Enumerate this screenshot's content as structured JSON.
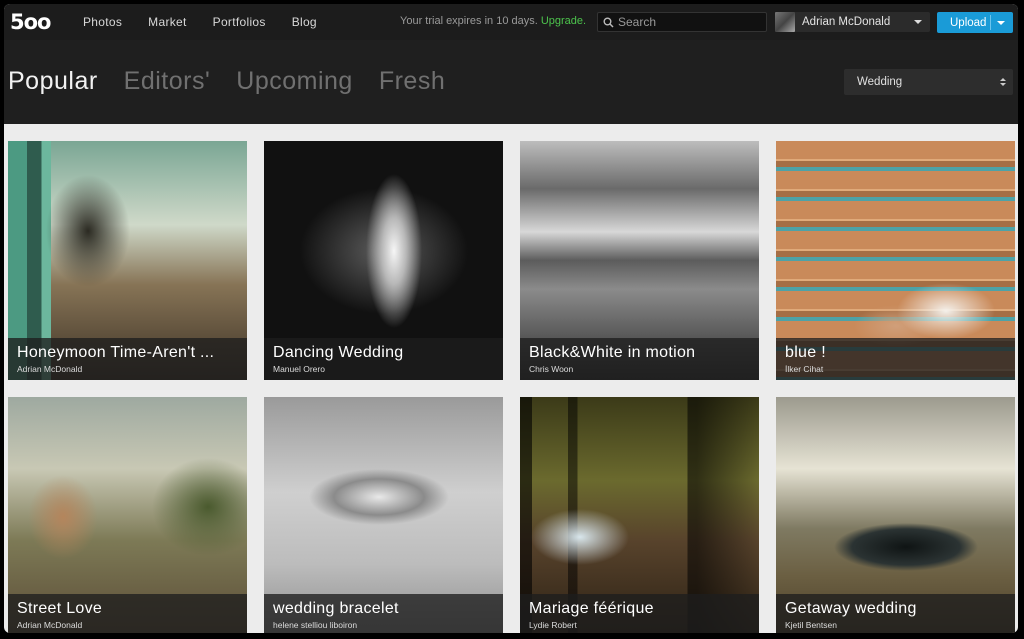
{
  "header": {
    "logo": "5oo",
    "nav": [
      "Photos",
      "Market",
      "Portfolios",
      "Blog"
    ],
    "trial_text": "Your trial expires in 10 days.",
    "trial_link": "Upgrade.",
    "search_placeholder": "Search",
    "user_name": "Adrian McDonald",
    "upload_label": "Upload"
  },
  "subheader": {
    "tabs": [
      {
        "label": "Popular",
        "active": true
      },
      {
        "label": "Editors'",
        "active": false
      },
      {
        "label": "Upcoming",
        "active": false
      },
      {
        "label": "Fresh",
        "active": false
      }
    ],
    "category": "Wedding"
  },
  "photos": [
    {
      "title": "Honeymoon Time-Aren't ...",
      "author": "Adrian McDonald"
    },
    {
      "title": "Dancing Wedding",
      "author": "Manuel Orero"
    },
    {
      "title": "Black&White in motion",
      "author": "Chris Woon"
    },
    {
      "title": "blue !",
      "author": "İlker Cihat"
    },
    {
      "title": "Street Love",
      "author": "Adrian McDonald"
    },
    {
      "title": "wedding bracelet",
      "author": "helene stelliou liboiron"
    },
    {
      "title": "Mariage féérique",
      "author": "Lydie Robert"
    },
    {
      "title": "Getaway wedding",
      "author": "Kjetil Bentsen"
    }
  ],
  "colors": {
    "accent_upload": "#1a9bd7",
    "upgrade_link": "#4cc34c",
    "topbar": "#1c1c1c"
  }
}
